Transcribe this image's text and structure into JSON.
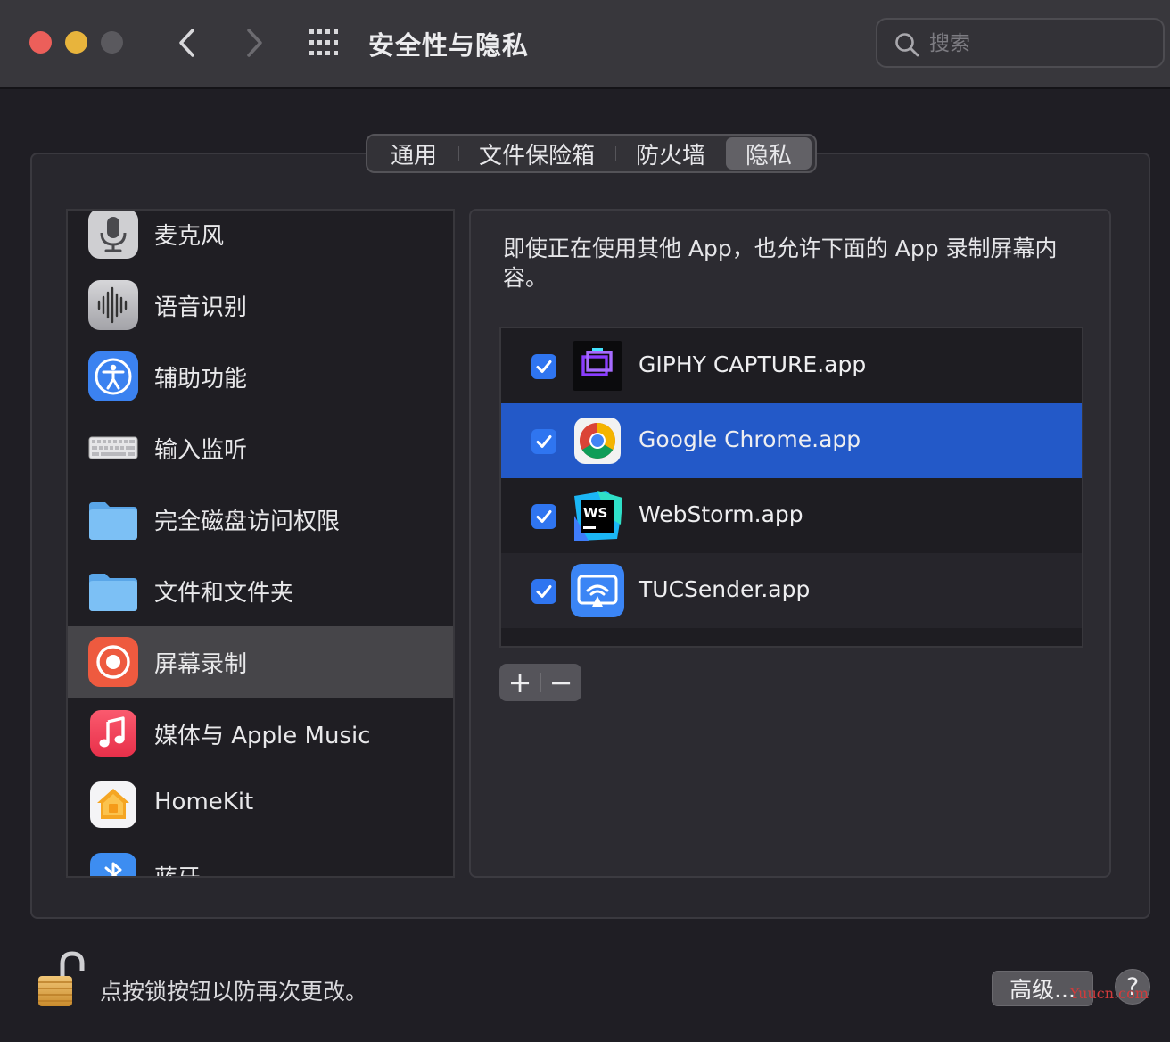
{
  "window": {
    "title": "安全性与隐私"
  },
  "search": {
    "placeholder": "搜索",
    "value": ""
  },
  "tabs": [
    {
      "label": "通用",
      "active": false
    },
    {
      "label": "文件保险箱",
      "active": false
    },
    {
      "label": "防火墙",
      "active": false
    },
    {
      "label": "隐私",
      "active": true
    }
  ],
  "sidebar": {
    "items": [
      {
        "label": "麦克风",
        "icon": "microphone-icon"
      },
      {
        "label": "语音识别",
        "icon": "waveform-icon"
      },
      {
        "label": "辅助功能",
        "icon": "accessibility-icon"
      },
      {
        "label": "输入监听",
        "icon": "keyboard-icon"
      },
      {
        "label": "完全磁盘访问权限",
        "icon": "folder-icon"
      },
      {
        "label": "文件和文件夹",
        "icon": "folder-icon"
      },
      {
        "label": "屏幕录制",
        "icon": "screen-record-icon",
        "selected": true
      },
      {
        "label": "媒体与 Apple Music",
        "icon": "music-icon"
      },
      {
        "label": "HomeKit",
        "icon": "homekit-icon"
      },
      {
        "label": "蓝牙",
        "icon": "bluetooth-icon"
      }
    ]
  },
  "content": {
    "description": "即使正在使用其他 App，也允许下面的 App 录制屏幕内容。",
    "apps": [
      {
        "name": "GIPHY CAPTURE.app",
        "checked": true,
        "icon": "giphy-capture-icon"
      },
      {
        "name": "Google Chrome.app",
        "checked": true,
        "icon": "chrome-icon",
        "selected": true
      },
      {
        "name": "WebStorm.app",
        "checked": true,
        "icon": "webstorm-icon"
      },
      {
        "name": "TUCSender.app",
        "checked": true,
        "icon": "tucsender-icon"
      }
    ],
    "add_label": "+",
    "remove_label": "−"
  },
  "footer": {
    "lock_text": "点按锁按钮以防再次更改。",
    "advanced_label": "高级...",
    "help_label": "?"
  },
  "watermark": "Yuucn.com",
  "colors": {
    "accent": "#2f75f0",
    "selection": "#2359c8",
    "close": "#ec5f5a",
    "minimize": "#e8b43c"
  }
}
